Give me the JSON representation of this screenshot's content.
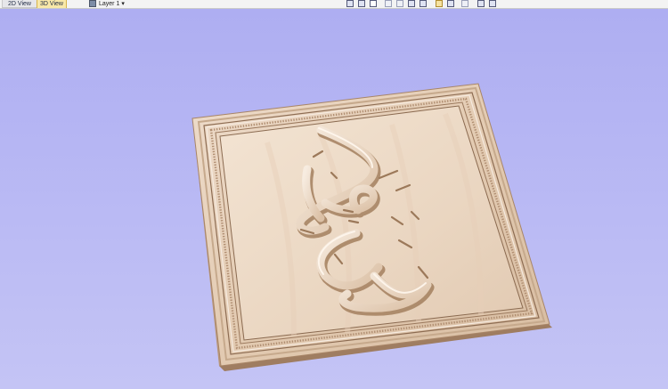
{
  "tabs": [
    {
      "label": "2D View",
      "active": false
    },
    {
      "label": "3D View",
      "active": true
    }
  ],
  "layer_selector": {
    "label": "Layer 1",
    "dropdown_glyph": "▾"
  },
  "toolbar_icons": [
    "fit-view-icon",
    "fit-selection-icon",
    "grid-icon",
    "iso-view-icon",
    "zoom-in-icon",
    "zoom-extents-icon",
    "zoom-window-icon",
    "shaded-view-icon",
    "wireframe-view-icon",
    "light-bulb-icon",
    "split-vertical-icon",
    "split-horizontal-icon"
  ],
  "colors": {
    "background_top": "#aeaef2",
    "background_bottom": "#c4c4f5",
    "wood_light": "#f0dfcc",
    "wood_mid": "#d9bea4",
    "wood_dark": "#a98566",
    "active_tab": "#f8e8a8"
  },
  "scene": {
    "object": "carved-wood-panel",
    "subject": "arabic-calligraphy-relief"
  }
}
